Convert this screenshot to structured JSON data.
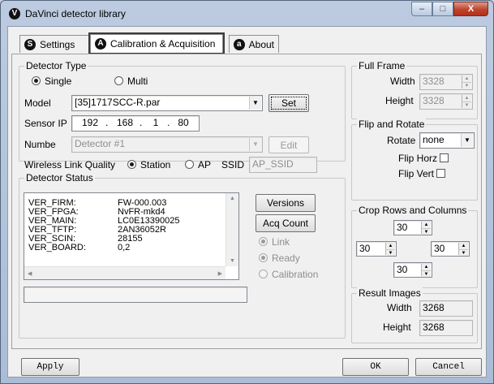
{
  "window": {
    "title": "DaVinci detector library",
    "title_icon": "V",
    "controls": {
      "minimize": "–",
      "maximize": "□",
      "close": "X"
    }
  },
  "tabs": [
    {
      "label": "Settings",
      "icon": "S"
    },
    {
      "label": "Calibration & Acquisition",
      "icon": "A"
    },
    {
      "label": "About",
      "icon": "a"
    }
  ],
  "detector_type": {
    "label": "Detector Type",
    "single": "Single",
    "multi": "Multi",
    "model_label": "Model",
    "model_value": "[35]1717SCC-R.par",
    "set_button": "Set",
    "sensor_ip_label": "Sensor IP",
    "ip": [
      "192",
      "168",
      "1",
      "80"
    ],
    "numbe_label": "Numbe",
    "numbe_value": "Detector #1",
    "edit_button": "Edit",
    "wireless_label": "Wireless Link Quality",
    "station": "Station",
    "ap": "AP",
    "ssid_label": "SSID",
    "ssid_value": "AP_SSID"
  },
  "detector_status": {
    "label": "Detector Status",
    "rows": [
      {
        "key": "VER_FIRM:",
        "value": "FW-000.003"
      },
      {
        "key": "VER_FPGA:",
        "value": "NvFR-mkd4"
      },
      {
        "key": "VER_MAIN:",
        "value": "LC0E13390025"
      },
      {
        "key": "VER_TFTP:",
        "value": "2AN36052R"
      },
      {
        "key": "VER_SCIN:",
        "value": "28155"
      },
      {
        "key": "VER_BOARD:",
        "value": "0,2"
      }
    ],
    "versions_button": "Versions",
    "acq_count_button": "Acq Count",
    "link": "Link",
    "ready": "Ready",
    "calibration": "Calibration"
  },
  "full_frame": {
    "label": "Full Frame",
    "width_label": "Width",
    "width_value": "3328",
    "height_label": "Height",
    "height_value": "3328"
  },
  "flip_rotate": {
    "label": "Flip and Rotate",
    "rotate_label": "Rotate",
    "rotate_value": "none",
    "flip_horz": "Flip Horz",
    "flip_vert": "Flip Vert"
  },
  "crop": {
    "label": "Crop Rows and Columns",
    "top": "30",
    "left": "30",
    "right": "30",
    "bottom": "30"
  },
  "result_images": {
    "label": "Result Images",
    "width_label": "Width",
    "width_value": "3268",
    "height_label": "Height",
    "height_value": "3268"
  },
  "footer": {
    "apply": "Apply",
    "ok": "OK",
    "cancel": "Cancel"
  }
}
